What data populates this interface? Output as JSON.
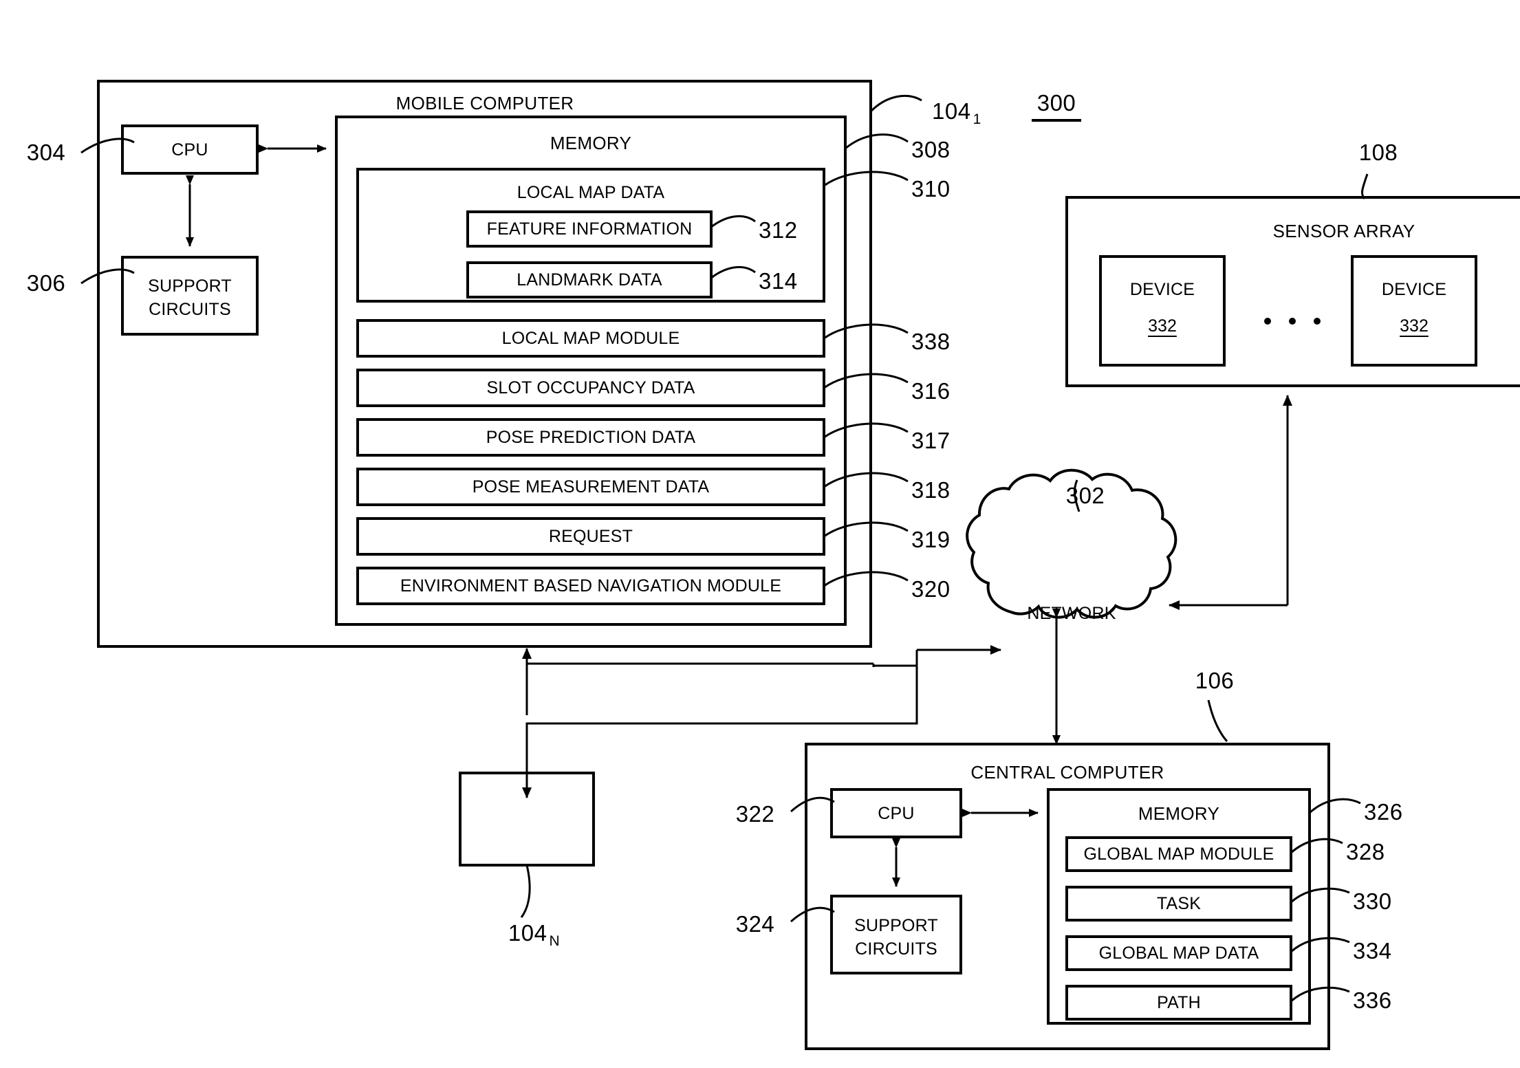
{
  "figure": {
    "number": "300"
  },
  "mobile_computer": {
    "title": "MOBILE COMPUTER",
    "ref": "104",
    "ref_sub": "1",
    "cpu": {
      "label": "CPU",
      "ref": "304"
    },
    "support_circuits": {
      "label_line1": "SUPPORT",
      "label_line2": "CIRCUITS",
      "ref": "306"
    },
    "memory": {
      "title": "MEMORY",
      "ref": "308",
      "local_map_data": {
        "title": "LOCAL MAP DATA",
        "ref": "310",
        "items": [
          {
            "label": "FEATURE INFORMATION",
            "ref": "312"
          },
          {
            "label": "LANDMARK DATA",
            "ref": "314"
          }
        ]
      },
      "items": [
        {
          "label": "LOCAL MAP MODULE",
          "ref": "338"
        },
        {
          "label": "SLOT OCCUPANCY DATA",
          "ref": "316"
        },
        {
          "label": "POSE PREDICTION DATA",
          "ref": "317"
        },
        {
          "label": "POSE MEASUREMENT DATA",
          "ref": "318"
        },
        {
          "label": "REQUEST",
          "ref": "319"
        },
        {
          "label": "ENVIRONMENT BASED NAVIGATION MODULE",
          "ref": "320"
        }
      ]
    }
  },
  "mobile_computer_n": {
    "ref": "104",
    "ref_sub": "N"
  },
  "sensor_array": {
    "title": "SENSOR ARRAY",
    "ref": "108",
    "devices": [
      {
        "label": "DEVICE",
        "ref": "332"
      },
      {
        "label": "DEVICE",
        "ref": "332"
      }
    ],
    "ellipsis": "• • •"
  },
  "network": {
    "label": "NETWORK",
    "ref": "302"
  },
  "central_computer": {
    "title": "CENTRAL COMPUTER",
    "ref": "106",
    "cpu": {
      "label": "CPU",
      "ref": "322"
    },
    "support_circuits": {
      "label_line1": "SUPPORT",
      "label_line2": "CIRCUITS",
      "ref": "324"
    },
    "memory": {
      "title": "MEMORY",
      "ref": "326",
      "items": [
        {
          "label": "GLOBAL MAP MODULE",
          "ref": "328"
        },
        {
          "label": "TASK",
          "ref": "330"
        },
        {
          "label": "GLOBAL MAP DATA",
          "ref": "334"
        },
        {
          "label": "PATH",
          "ref": "336"
        }
      ]
    }
  },
  "colors": {
    "stroke": "#000000",
    "background": "#ffffff"
  }
}
